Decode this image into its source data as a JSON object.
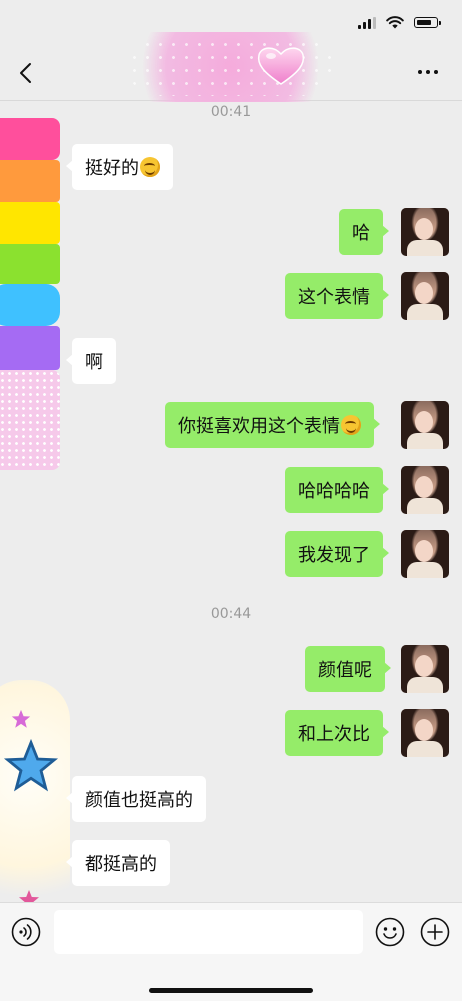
{
  "chat": {
    "timestamps": [
      "00:41",
      "00:44"
    ],
    "messages": [
      {
        "side": "in",
        "text": "挺好的",
        "emoji": "grinning-sweat-emoji"
      },
      {
        "side": "out",
        "text": "哈"
      },
      {
        "side": "out",
        "text": "这个表情"
      },
      {
        "side": "in",
        "text": "啊"
      },
      {
        "side": "out",
        "text": "你挺喜欢用这个表情",
        "emoji": "grinning-sweat-emoji"
      },
      {
        "side": "out",
        "text": "哈哈哈哈"
      },
      {
        "side": "out",
        "text": "我发现了"
      },
      {
        "side": "out",
        "text": "颜值呢"
      },
      {
        "side": "out",
        "text": "和上次比"
      },
      {
        "side": "in",
        "text": "颜值也挺高的"
      },
      {
        "side": "in",
        "text": "都挺高的"
      }
    ]
  },
  "input": {
    "value": "",
    "placeholder": ""
  },
  "icons": {
    "back": "chevron-left-icon",
    "more": "more-dots-icon",
    "voice": "voice-icon",
    "emoji": "smiley-icon",
    "plus": "plus-icon"
  },
  "colors": {
    "outgoing_bubble": "#95ec69",
    "incoming_bubble": "#ffffff",
    "background": "#ededed"
  }
}
